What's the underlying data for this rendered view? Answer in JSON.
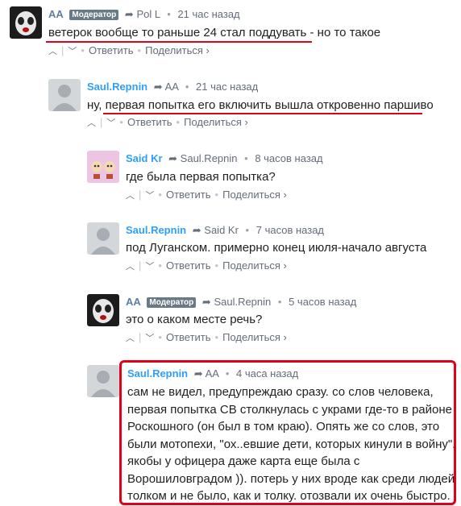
{
  "comments": [
    {
      "author": "AA",
      "badge": "Модератор",
      "reply_to": "Pol L",
      "time": "21 час назад",
      "body": [
        "ветерок вообще то раньше 24 стал поддувать - но то такое"
      ],
      "reply_label": "Ответить",
      "share_label": "Поделиться ›"
    },
    {
      "author": "Saul.Repnin",
      "reply_to": "AA",
      "time": "21 час назад",
      "body": [
        "ну, первая попытка его включить вышла откровенно паршиво"
      ],
      "reply_label": "Ответить",
      "share_label": "Поделиться ›"
    },
    {
      "author": "Said Kr",
      "reply_to": "Saul.Repnin",
      "time": "8 часов назад",
      "body": [
        "где была первая попытка?"
      ],
      "reply_label": "Ответить",
      "share_label": "Поделиться ›"
    },
    {
      "author": "Saul.Repnin",
      "reply_to": "Said Kr",
      "time": "7 часов назад",
      "body": [
        "под Луганском. примерно конец июля-начало августа"
      ],
      "reply_label": "Ответить",
      "share_label": "Поделиться ›"
    },
    {
      "author": "AA",
      "badge": "Модератор",
      "reply_to": "Saul.Repnin",
      "time": "5 часов назад",
      "body": [
        "это о каком месте речь?"
      ],
      "reply_label": "Ответить",
      "share_label": "Поделиться ›"
    },
    {
      "author": "Saul.Repnin",
      "reply_to": "AA",
      "time": "4 часа назад",
      "body": [
        "сам не видел, предупреждаю сразу. со слов человека,",
        "первая попытка СВ столкнулась с украми где-то в районе",
        "Роскошного (он был в том краю). Опять же со слов, это",
        "были мотопехи, \"ох..евшие дети, которых кинули в войну\".",
        "якобы у офицера даже карта еще была с",
        "Ворошиловградом )). потерь у них вроде как среди людей",
        "толком и не было, как и толку. отозвали их очень быстро."
      ]
    }
  ],
  "icons": {
    "upvote": "chevron-up-icon",
    "downvote": "chevron-down-icon",
    "reply_arrow": "reply-arrow-icon"
  },
  "colors": {
    "author": "#2e9fff",
    "highlight": "#e0001a",
    "badge": "#687a86"
  }
}
